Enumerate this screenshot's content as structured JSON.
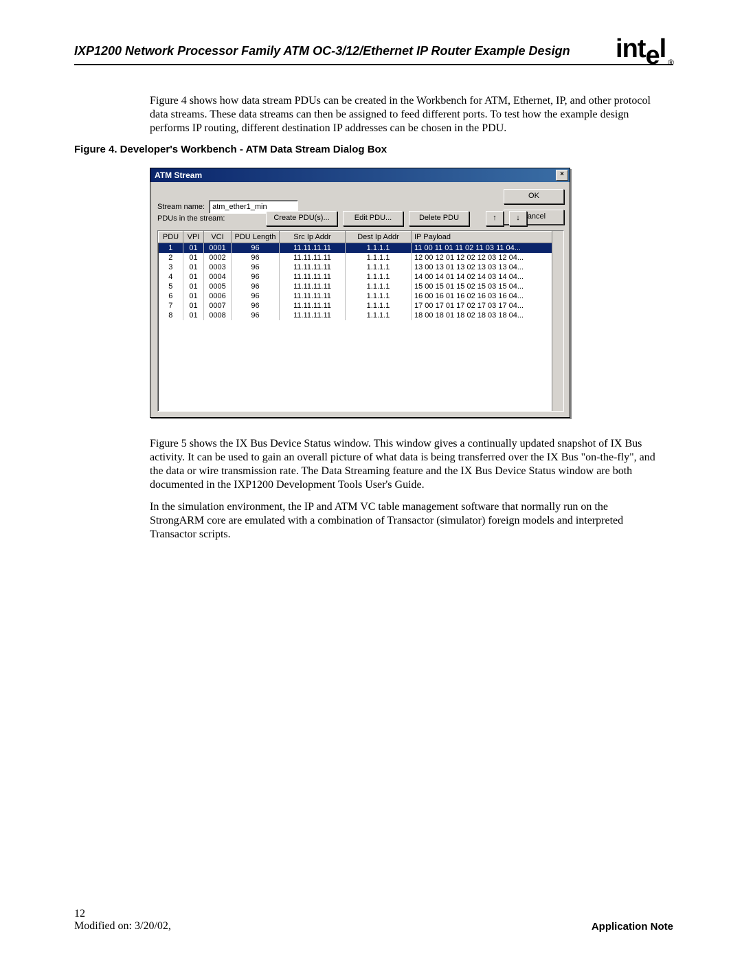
{
  "header": {
    "doc_title": "IXP1200 Network Processor Family ATM OC-3/12/Ethernet IP Router Example Design",
    "logo_text": "intel",
    "logo_reg": "®"
  },
  "paragraphs": {
    "p1": "Figure 4 shows how data stream PDUs can be created in the Workbench for ATM, Ethernet, IP, and other protocol data streams. These data streams can then be assigned to feed different ports. To test how the example design performs IP routing, different destination IP addresses can be chosen in the PDU.",
    "p2": "Figure 5 shows the IX Bus Device Status window. This window gives a continually updated snapshot of IX Bus activity. It can be used to gain an overall picture of what data is being transferred over the IX Bus \"on-the-fly\", and the data or wire transmission rate. The Data Streaming feature and the IX Bus Device Status window are both documented in the IXP1200 Development Tools User's Guide.",
    "p3": "In the simulation environment, the IP and ATM VC table management software that normally run on the StrongARM core are emulated with a combination of Transactor (simulator) foreign models and interpreted Transactor scripts."
  },
  "figure_caption": "Figure 4.  Developer's Workbench - ATM Data Stream Dialog Box",
  "dialog": {
    "title": "ATM Stream",
    "close_glyph": "×",
    "stream_name_label": "Stream name:",
    "stream_name_value": "atm_ether1_min",
    "pdus_label": "PDUs in the stream:",
    "btn_create": "Create PDU(s)...",
    "btn_edit": "Edit PDU...",
    "btn_delete": "Delete PDU",
    "btn_up": "↑",
    "btn_down": "↓",
    "btn_ok": "OK",
    "btn_cancel": "Cancel",
    "columns": [
      "PDU",
      "VPI",
      "VCI",
      "PDU Length",
      "Src Ip Addr",
      "Dest Ip Addr",
      "IP Payload"
    ],
    "rows": [
      {
        "pdu": "1",
        "vpi": "01",
        "vci": "0001",
        "len": "96",
        "src": "11.11.11.11",
        "dst": "1.1.1.1",
        "payload": "11 00 11 01 11 02 11 03 11 04..."
      },
      {
        "pdu": "2",
        "vpi": "01",
        "vci": "0002",
        "len": "96",
        "src": "11.11.11.11",
        "dst": "1.1.1.1",
        "payload": "12 00 12 01 12 02 12 03 12 04..."
      },
      {
        "pdu": "3",
        "vpi": "01",
        "vci": "0003",
        "len": "96",
        "src": "11.11.11.11",
        "dst": "1.1.1.1",
        "payload": "13 00 13 01 13 02 13 03 13 04..."
      },
      {
        "pdu": "4",
        "vpi": "01",
        "vci": "0004",
        "len": "96",
        "src": "11.11.11.11",
        "dst": "1.1.1.1",
        "payload": "14 00 14 01 14 02 14 03 14 04..."
      },
      {
        "pdu": "5",
        "vpi": "01",
        "vci": "0005",
        "len": "96",
        "src": "11.11.11.11",
        "dst": "1.1.1.1",
        "payload": "15 00 15 01 15 02 15 03 15 04..."
      },
      {
        "pdu": "6",
        "vpi": "01",
        "vci": "0006",
        "len": "96",
        "src": "11.11.11.11",
        "dst": "1.1.1.1",
        "payload": "16 00 16 01 16 02 16 03 16 04..."
      },
      {
        "pdu": "7",
        "vpi": "01",
        "vci": "0007",
        "len": "96",
        "src": "11.11.11.11",
        "dst": "1.1.1.1",
        "payload": "17 00 17 01 17 02 17 03 17 04..."
      },
      {
        "pdu": "8",
        "vpi": "01",
        "vci": "0008",
        "len": "96",
        "src": "11.11.11.11",
        "dst": "1.1.1.1",
        "payload": "18 00 18 01 18 02 18 03 18 04..."
      }
    ],
    "selected_row_index": 0
  },
  "footer": {
    "page_number": "12",
    "modified": "Modified on: 3/20/02,",
    "app_note": "Application Note"
  }
}
